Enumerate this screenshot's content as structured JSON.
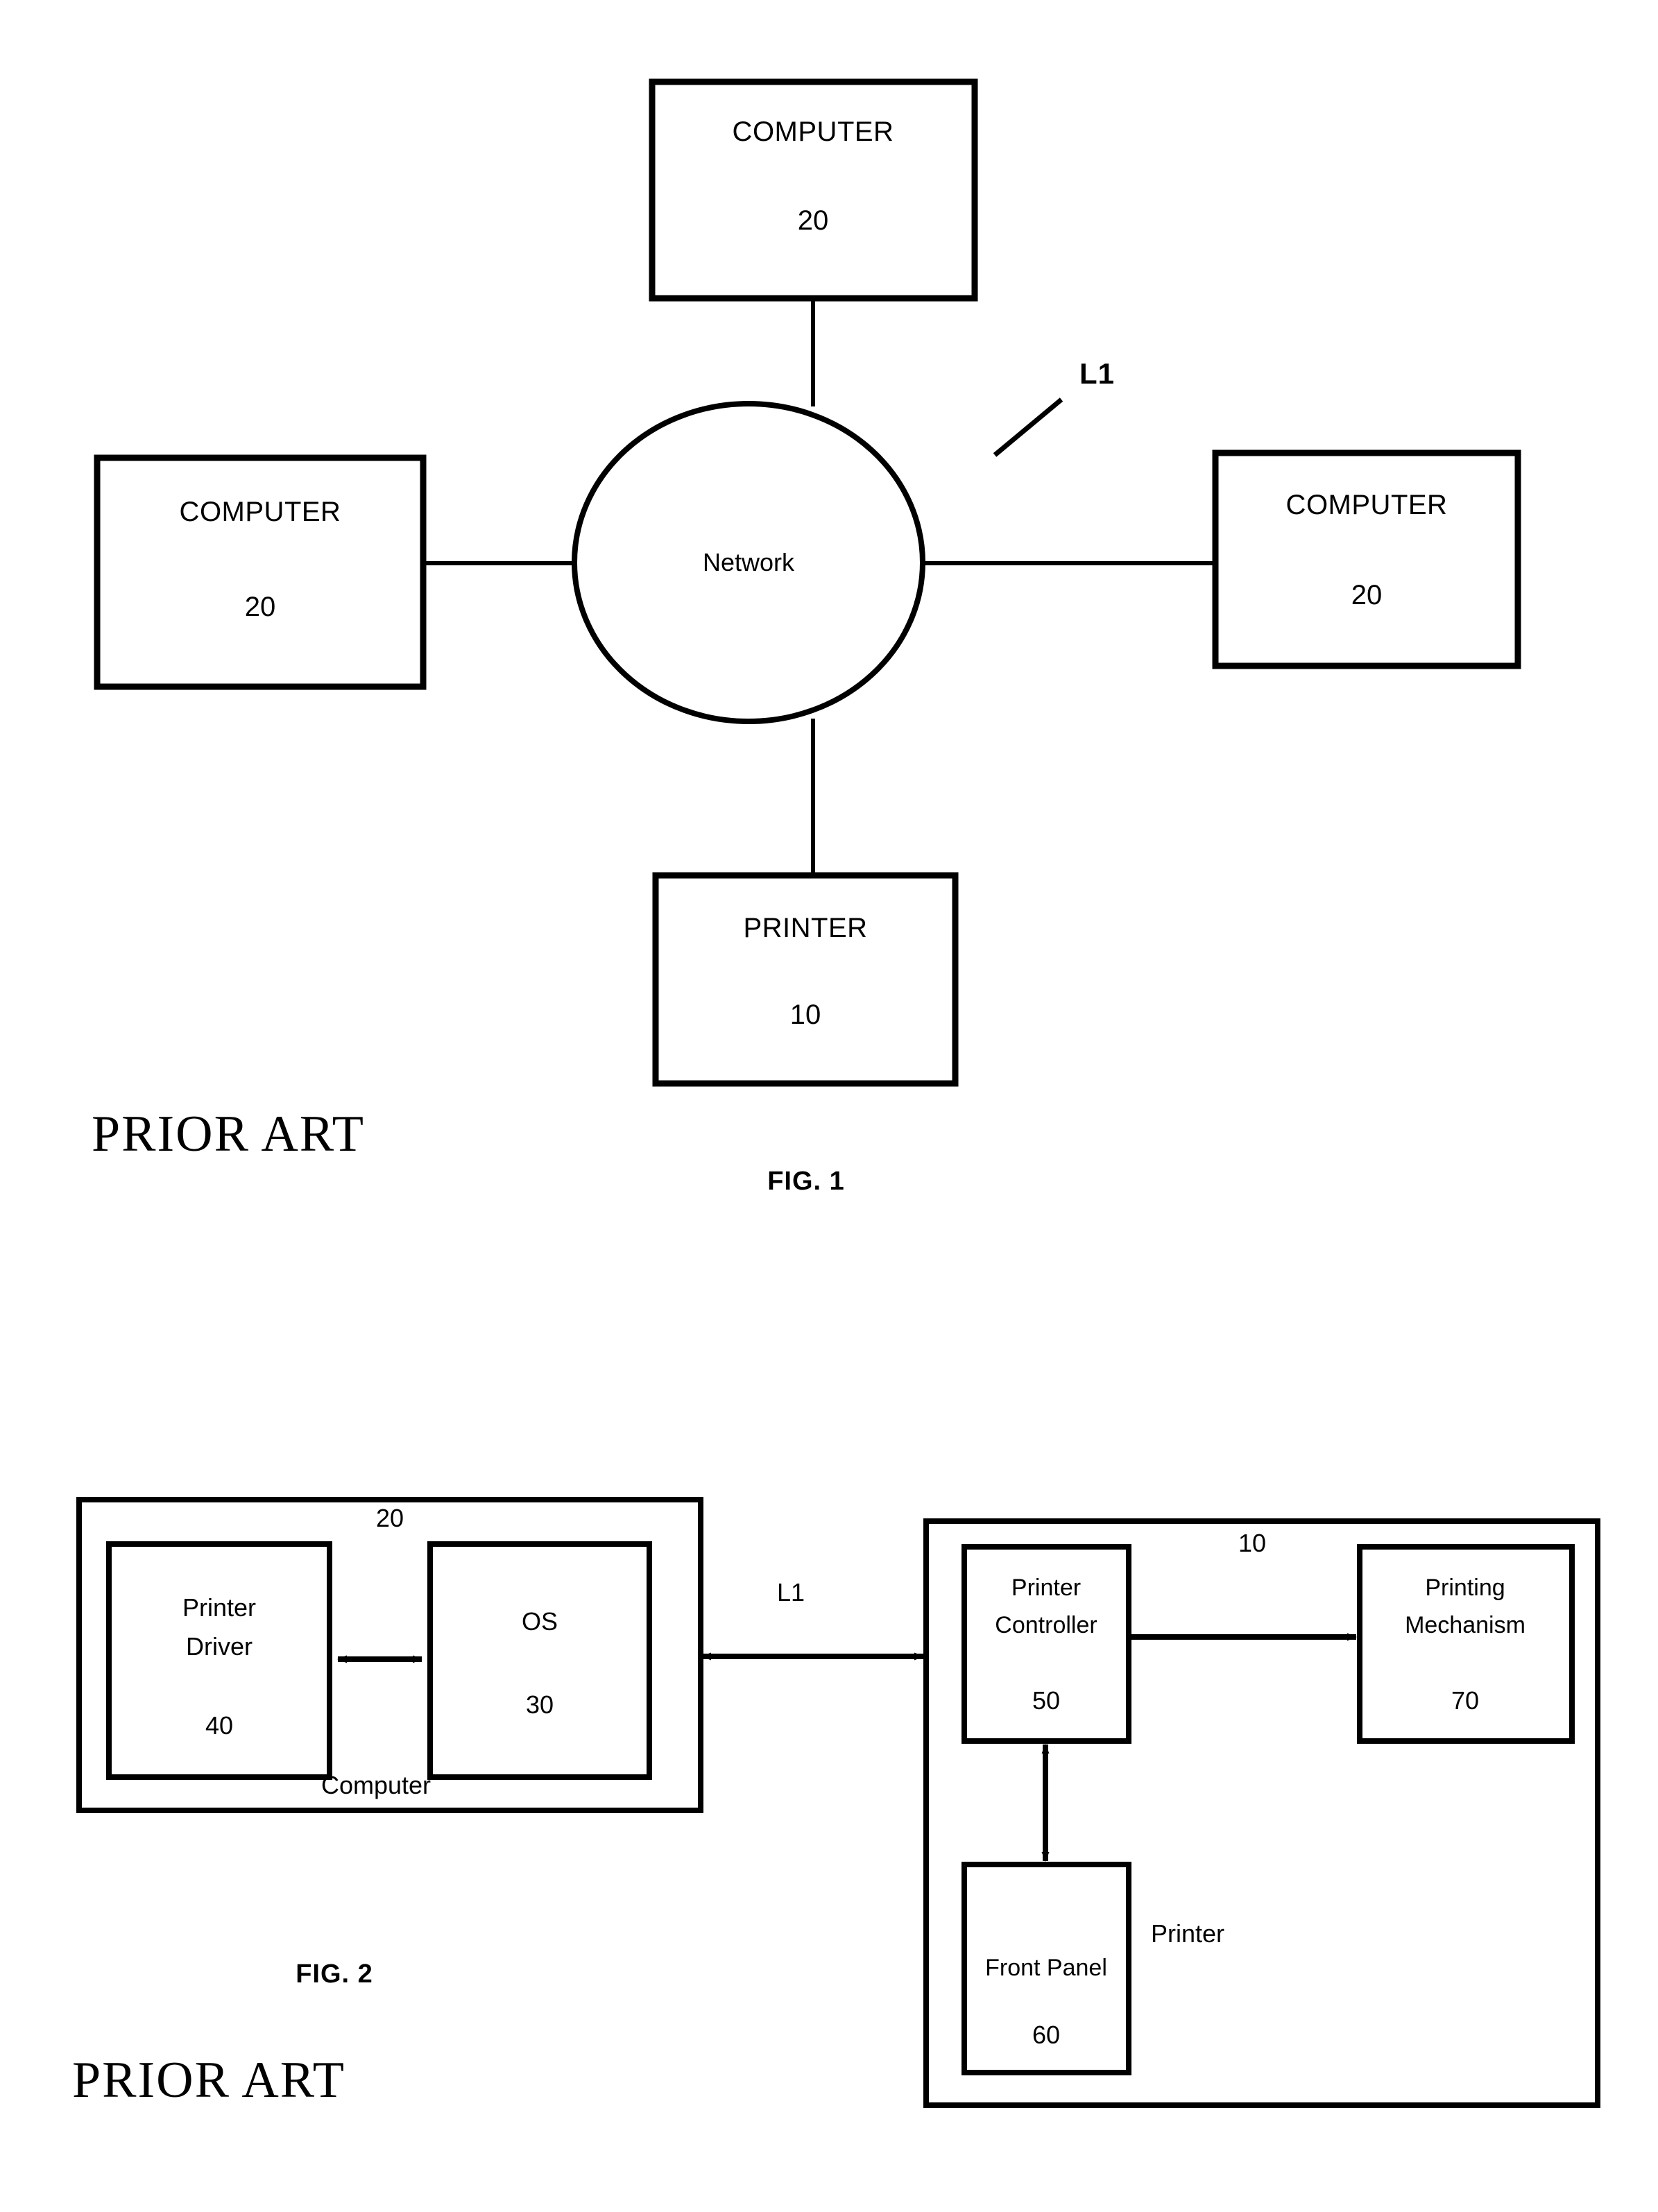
{
  "figure1": {
    "caption": "FIG. 1",
    "prior_art": "PRIOR ART",
    "network_label": "Network",
    "link_label": "L1",
    "nodes": {
      "computer_top": {
        "title": "COMPUTER",
        "ref": "20"
      },
      "computer_left": {
        "title": "COMPUTER",
        "ref": "20"
      },
      "computer_right": {
        "title": "COMPUTER",
        "ref": "20"
      },
      "printer_bottom": {
        "title": "PRINTER",
        "ref": "10"
      }
    }
  },
  "figure2": {
    "caption": "FIG. 2",
    "prior_art": "PRIOR ART",
    "link_label": "L1",
    "computer_group": {
      "ref": "20",
      "caption": "Computer",
      "blocks": [
        {
          "title_line1": "Printer",
          "title_line2": "Driver",
          "ref": "40"
        },
        {
          "title_line1": "OS",
          "title_line2": "",
          "ref": "30"
        }
      ]
    },
    "printer_group": {
      "ref": "10",
      "caption": "Printer",
      "blocks": [
        {
          "title_line1": "Printer",
          "title_line2": "Controller",
          "ref": "50"
        },
        {
          "title_line1": "Printing",
          "title_line2": "Mechanism",
          "ref": "70"
        },
        {
          "title_line1": "Front Panel",
          "title_line2": "",
          "ref": "60"
        }
      ]
    }
  },
  "style": {
    "ink": "#000000",
    "paper": "#ffffff"
  }
}
